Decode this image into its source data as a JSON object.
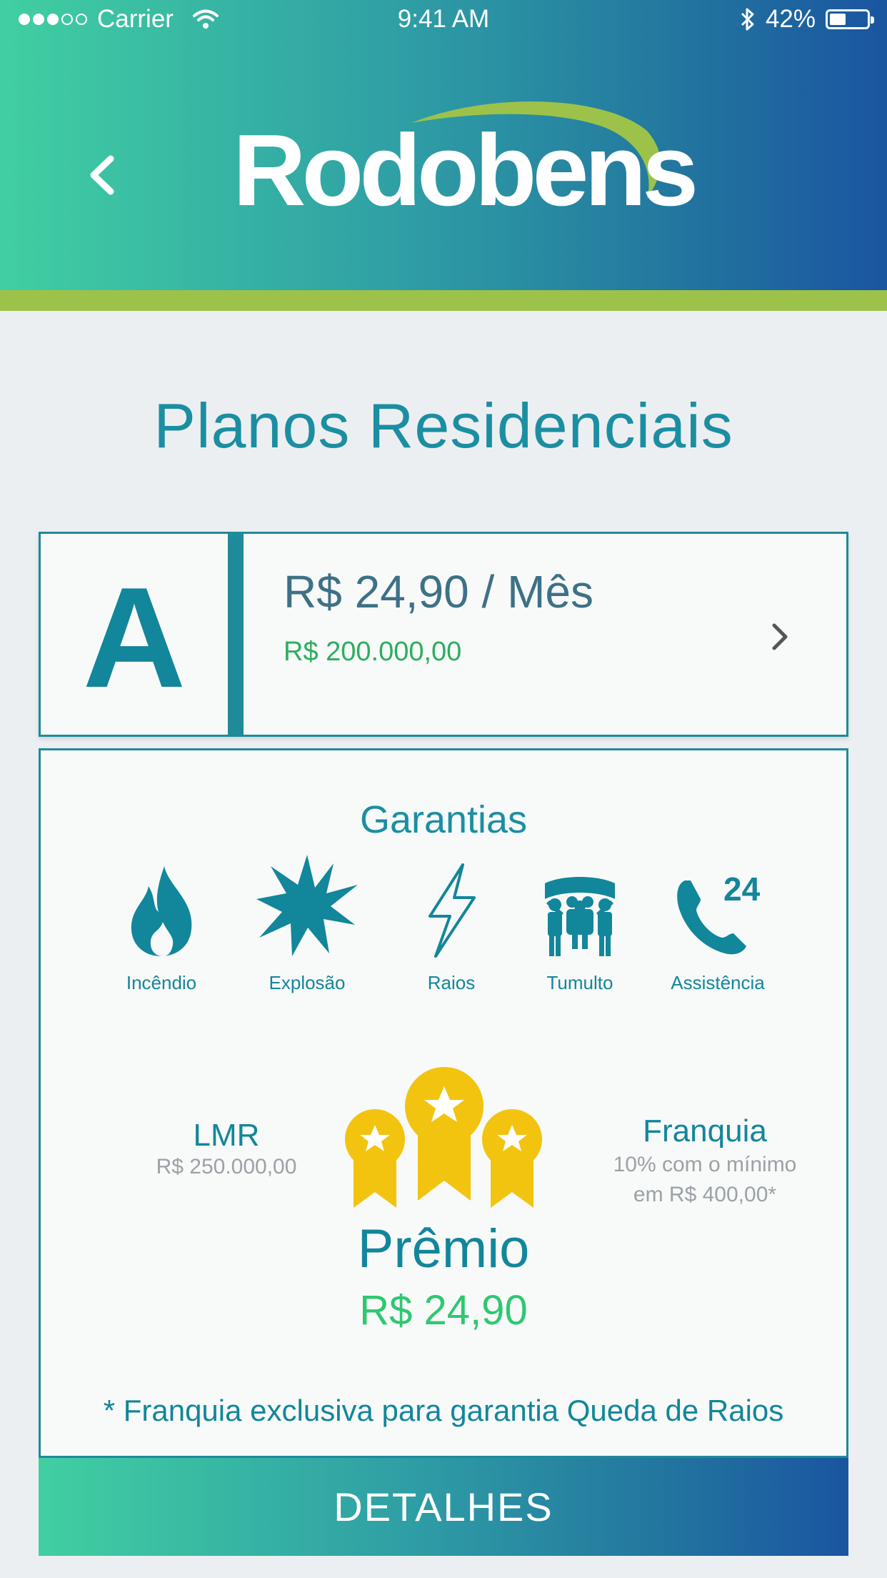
{
  "status_bar": {
    "carrier": "Carrier",
    "time": "9:41 AM",
    "battery": "42%",
    "signal_icon": "signal-dots-icon",
    "wifi_icon": "wifi-icon",
    "bluetooth_icon": "bluetooth-icon"
  },
  "header": {
    "back_icon": "chevron-left-icon",
    "logo_text": "Rodobens",
    "colors": {
      "gradient_start": "#41cfa2",
      "gradient_end": "#1a55a0",
      "accent_stripe": "#9dc24a"
    }
  },
  "page": {
    "title": "Planos Residenciais"
  },
  "plan": {
    "letter": "A",
    "price": "R$ 24,90 / Mês",
    "coverage": "R$ 200.000,00",
    "chevron_icon": "chevron-right-icon"
  },
  "garantias": {
    "title": "Garantias",
    "items": [
      {
        "label": "Incêndio",
        "icon": "fire-icon"
      },
      {
        "label": "Explosão",
        "icon": "explosion-icon"
      },
      {
        "label": "Raios",
        "icon": "lightning-icon"
      },
      {
        "label": "Tumulto",
        "icon": "crowd-icon"
      },
      {
        "label": "Assistência",
        "icon": "phone-24h-icon",
        "badge": "24"
      }
    ]
  },
  "lmr": {
    "title": "LMR",
    "value": "R$ 250.000,00"
  },
  "franquia": {
    "title": "Franquia",
    "line1": "10% com o mínimo",
    "line2": "em R$ 400,00*"
  },
  "premio": {
    "title": "Prêmio",
    "value": "R$ 24,90",
    "icon": "award-medals-icon"
  },
  "footnote": "* Franquia exclusiva para garantia Queda de Raios",
  "details_button": "DETALHES"
}
